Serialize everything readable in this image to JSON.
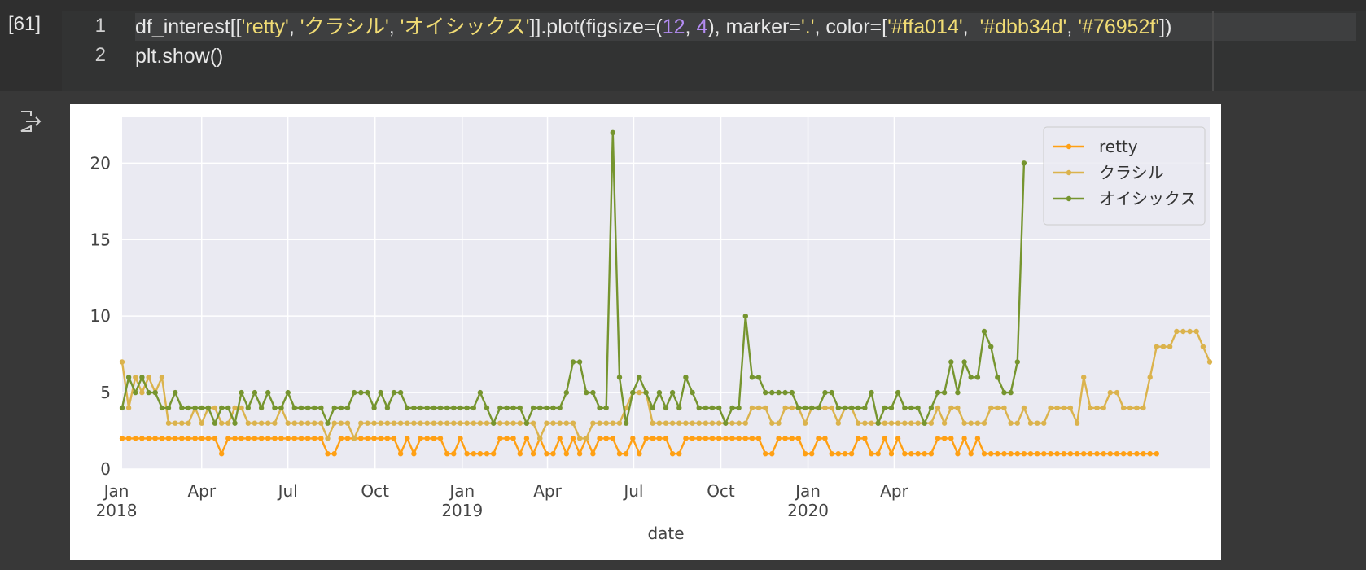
{
  "cell": {
    "execution_count": "[61]",
    "lines": [
      {
        "number": "1",
        "tokens": [
          {
            "text": "df_interest[[",
            "kind": "plain"
          },
          {
            "text": "'retty'",
            "kind": "string"
          },
          {
            "text": ", ",
            "kind": "plain"
          },
          {
            "text": "'クラシル'",
            "kind": "string"
          },
          {
            "text": ", ",
            "kind": "plain"
          },
          {
            "text": "'オイシックス'",
            "kind": "string"
          },
          {
            "text": "]].plot(figsize=(",
            "kind": "plain"
          },
          {
            "text": "12",
            "kind": "number"
          },
          {
            "text": ", ",
            "kind": "plain"
          },
          {
            "text": "4",
            "kind": "number"
          },
          {
            "text": "), marker=",
            "kind": "plain"
          },
          {
            "text": "'.'",
            "kind": "string"
          },
          {
            "text": ", color=[",
            "kind": "plain"
          },
          {
            "text": "'#ffa014'",
            "kind": "string"
          },
          {
            "text": ",  ",
            "kind": "plain"
          },
          {
            "text": "'#dbb34d'",
            "kind": "string"
          },
          {
            "text": ", ",
            "kind": "plain"
          },
          {
            "text": "'#76952f'",
            "kind": "string"
          },
          {
            "text": "])",
            "kind": "plain"
          }
        ]
      },
      {
        "number": "2",
        "tokens": [
          {
            "text": "plt.show()",
            "kind": "plain"
          }
        ]
      }
    ]
  },
  "output": {
    "icon": "output-redirect-icon"
  },
  "chart_data": {
    "type": "line",
    "title": "",
    "xlabel": "date",
    "ylabel": "",
    "ylim": [
      0,
      23
    ],
    "yticks": [
      0,
      5,
      10,
      15,
      20
    ],
    "x_start": "2018-01-07",
    "x_step_days": 7,
    "xticks": [
      {
        "date": "2018-01-01",
        "label": "Jan",
        "year": "2018"
      },
      {
        "date": "2018-04-01",
        "label": "Apr",
        "year": ""
      },
      {
        "date": "2018-07-01",
        "label": "Jul",
        "year": ""
      },
      {
        "date": "2018-10-01",
        "label": "Oct",
        "year": ""
      },
      {
        "date": "2019-01-01",
        "label": "Jan",
        "year": "2019"
      },
      {
        "date": "2019-04-01",
        "label": "Apr",
        "year": ""
      },
      {
        "date": "2019-07-01",
        "label": "Jul",
        "year": ""
      },
      {
        "date": "2019-10-01",
        "label": "Oct",
        "year": ""
      },
      {
        "date": "2020-01-01",
        "label": "Jan",
        "year": "2020"
      },
      {
        "date": "2020-04-01",
        "label": "Apr",
        "year": ""
      }
    ],
    "grid": true,
    "legend_position": "top-right",
    "background": "#eaeaf2",
    "series": [
      {
        "name": "retty",
        "color": "#ffa014",
        "values": [
          2,
          2,
          2,
          2,
          2,
          2,
          2,
          2,
          2,
          2,
          2,
          2,
          2,
          2,
          2,
          1,
          2,
          2,
          2,
          2,
          2,
          2,
          2,
          2,
          2,
          2,
          2,
          2,
          2,
          2,
          2,
          1,
          1,
          2,
          2,
          2,
          2,
          2,
          2,
          2,
          2,
          2,
          1,
          2,
          1,
          2,
          2,
          2,
          2,
          1,
          1,
          2,
          1,
          1,
          1,
          1,
          1,
          2,
          2,
          2,
          1,
          2,
          1,
          2,
          1,
          1,
          2,
          1,
          2,
          1,
          2,
          1,
          2,
          2,
          2,
          1,
          1,
          2,
          1,
          2,
          2,
          2,
          2,
          1,
          1,
          2,
          2,
          2,
          2,
          2,
          2,
          2,
          2,
          2,
          2,
          2,
          2,
          1,
          1,
          2,
          2,
          2,
          2,
          1,
          1,
          2,
          2,
          1,
          1,
          1,
          1,
          2,
          2,
          1,
          1,
          2,
          1,
          2,
          1,
          1,
          1,
          1,
          1,
          2,
          2,
          2,
          1,
          2,
          1,
          2,
          1,
          1,
          1,
          1,
          1,
          1,
          1,
          1,
          1,
          1,
          1,
          1,
          1,
          1,
          1,
          1,
          1,
          1,
          1,
          1,
          1,
          1,
          1,
          1,
          1,
          1,
          1
        ]
      },
      {
        "name": "クラシル",
        "color": "#dbb34d",
        "values": [
          7,
          4,
          6,
          5,
          6,
          5,
          6,
          3,
          3,
          3,
          3,
          4,
          3,
          4,
          4,
          3,
          3,
          4,
          4,
          3,
          3,
          3,
          3,
          3,
          4,
          3,
          3,
          3,
          3,
          3,
          3,
          2,
          3,
          3,
          3,
          2,
          3,
          3,
          3,
          3,
          3,
          3,
          3,
          3,
          3,
          3,
          3,
          3,
          3,
          3,
          3,
          3,
          3,
          3,
          3,
          3,
          3,
          3,
          3,
          3,
          3,
          3,
          3,
          2,
          3,
          3,
          3,
          3,
          3,
          2,
          2,
          3,
          3,
          3,
          3,
          3,
          4,
          5,
          5,
          5,
          3,
          3,
          3,
          3,
          3,
          3,
          3,
          3,
          3,
          3,
          3,
          3,
          3,
          3,
          3,
          4,
          4,
          4,
          3,
          3,
          4,
          4,
          4,
          3,
          4,
          4,
          4,
          4,
          3,
          4,
          4,
          3,
          3,
          3,
          3,
          3,
          3,
          3,
          3,
          3,
          3,
          3,
          3,
          4,
          3,
          4,
          4,
          3,
          3,
          3,
          3,
          4,
          4,
          4,
          3,
          3,
          4,
          3,
          3,
          3,
          4,
          4,
          4,
          4,
          3,
          6,
          4,
          4,
          4,
          5,
          5,
          4,
          4,
          4,
          4,
          6,
          8,
          8,
          8,
          9,
          9,
          9,
          9,
          8,
          7
        ]
      },
      {
        "name": "オイシックス",
        "color": "#76952f",
        "values": [
          4,
          6,
          5,
          6,
          5,
          5,
          4,
          4,
          5,
          4,
          4,
          4,
          4,
          4,
          3,
          4,
          4,
          3,
          5,
          4,
          5,
          4,
          5,
          4,
          4,
          5,
          4,
          4,
          4,
          4,
          4,
          3,
          4,
          4,
          4,
          5,
          5,
          5,
          4,
          5,
          4,
          5,
          5,
          4,
          4,
          4,
          4,
          4,
          4,
          4,
          4,
          4,
          4,
          4,
          5,
          4,
          3,
          4,
          4,
          4,
          4,
          3,
          4,
          4,
          4,
          4,
          4,
          5,
          7,
          7,
          5,
          5,
          4,
          4,
          22,
          6,
          3,
          5,
          6,
          5,
          4,
          5,
          4,
          5,
          4,
          6,
          5,
          4,
          4,
          4,
          4,
          3,
          4,
          4,
          10,
          6,
          6,
          5,
          5,
          5,
          5,
          5,
          4,
          4,
          4,
          4,
          5,
          5,
          4,
          4,
          4,
          4,
          4,
          5,
          3,
          4,
          4,
          5,
          4,
          4,
          4,
          3,
          4,
          5,
          5,
          7,
          5,
          7,
          6,
          6,
          9,
          8,
          6,
          5,
          5,
          7,
          20
        ]
      }
    ]
  }
}
